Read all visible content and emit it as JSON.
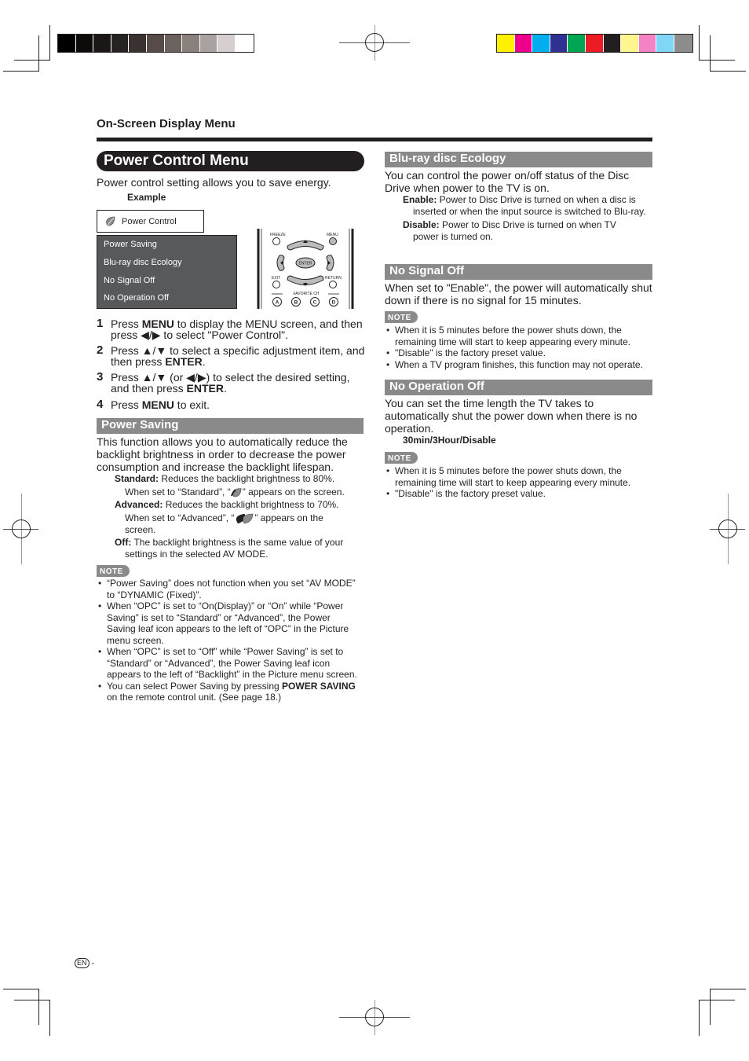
{
  "swatches": {
    "grayscale": [
      "#000000",
      "#0d0b0a",
      "#1a1716",
      "#272322",
      "#3a3231",
      "#564b48",
      "#6b625f",
      "#8a807c",
      "#a9a2a0",
      "#d5cfcf",
      "#ffffff"
    ],
    "colors": [
      "#fff100",
      "#ec008c",
      "#00aeef",
      "#2e3192",
      "#00a651",
      "#ed1c24",
      "#231f20",
      "#fff68f",
      "#f383c5",
      "#7fd6f7",
      "#8d8d8d"
    ]
  },
  "header": {
    "section_title": "On-Screen Display Menu"
  },
  "main": {
    "title": "Power Control Menu",
    "intro": "Power control setting allows you to save energy.",
    "example_label": "Example",
    "osd": {
      "title": "Power Control",
      "title_icon": "leaf-icon",
      "items": [
        "Power Saving",
        "Blu-ray disc Ecology",
        "No Signal Off",
        "No Operation Off"
      ]
    },
    "remote": {
      "freeze": "FREEZE",
      "menu": "MENU",
      "enter": "ENTER",
      "exit": "EXIT",
      "return": "RETURN",
      "favorite_ch": "FAVORITE CH",
      "buttons": [
        "A",
        "B",
        "C",
        "D"
      ]
    },
    "steps": [
      {
        "num": "1",
        "parts": [
          "Press ",
          "MENU",
          " to display the MENU screen, and then press ◀/▶ to select \"Power Control\"."
        ]
      },
      {
        "num": "2",
        "parts": [
          "Press ▲/▼ to select a specific adjustment item, and then press ",
          "ENTER",
          "."
        ]
      },
      {
        "num": "3",
        "parts": [
          "Press ▲/▼ (or ◀/▶) to select the desired setting, and then press ",
          "ENTER",
          "."
        ]
      },
      {
        "num": "4",
        "parts": [
          "Press ",
          "MENU",
          " to exit."
        ]
      }
    ]
  },
  "power_saving": {
    "heading": "Power Saving",
    "body": "This function allows you to automatically reduce the backlight brightness in order to decrease the power consumption and increase the backlight lifespan.",
    "standard_label": "Standard:",
    "standard_text": " Reduces the backlight brightness to 80%.",
    "standard_note_a": "When set to “Standard”, “",
    "standard_note_b": "” appears on the screen.",
    "advanced_label": "Advanced:",
    "advanced_text": " Reduces the backlight brightness to 70%.",
    "advanced_note_a": "When set to “Advanced”, “",
    "advanced_note_b": "” appears on the screen.",
    "off_label": "Off:",
    "off_text": " The backlight brightness is the same value of your settings in the selected AV MODE.",
    "note_label": "NOTE",
    "notes": [
      {
        "text": "“Power Saving” does not function when you set “AV MODE” to “DYNAMIC (Fixed)”."
      },
      {
        "text": "When “OPC” is set to “On(Display)” or “On” while “Power Saving” is set to “Standard” or “Advanced”, the Power Saving leaf icon appears to the left of “OPC” in the Picture menu screen."
      },
      {
        "text": "When “OPC” is set to “Off” while “Power Saving” is set to “Standard” or “Advanced”, the Power Saving leaf icon appears to the left of “Backlight” in the Picture menu screen."
      },
      {
        "text_a": "You can select Power Saving by pressing ",
        "bold": "POWER SAVING",
        "text_b": " on the remote control unit. (See page 18.)"
      }
    ]
  },
  "bluray": {
    "heading": "Blu-ray disc Ecology",
    "body": "You can control the power on/off status of the Disc Drive when power to the TV is on.",
    "enable_label": "Enable:",
    "enable_text": " Power to Disc Drive is turned on when a disc is inserted or when the input source is switched to Blu-ray.",
    "disable_label": "Disable:",
    "disable_text": " Power to Disc Drive is turned on when TV power is turned on."
  },
  "no_signal": {
    "heading": "No Signal Off",
    "body": "When set to \"Enable\", the power will automatically shut down if there is no signal for 15 minutes.",
    "note_label": "NOTE",
    "notes": [
      "When it is 5 minutes before the power shuts down, the remaining time will start to keep appearing every minute.",
      "\"Disable\" is the factory preset value.",
      "When a TV program finishes, this function may not operate."
    ]
  },
  "no_operation": {
    "heading": "No Operation Off",
    "body": "You can set the time length the TV takes to automatically shut the power down when there is no operation.",
    "options": "30min/3Hour/Disable",
    "note_label": "NOTE",
    "notes": [
      "When it is 5 minutes before the power shuts down, the remaining time will start to keep appearing every minute.",
      "\"Disable\" is the factory preset value."
    ]
  },
  "footer": {
    "lang_badge": "EN",
    "page_suffix": "-"
  }
}
